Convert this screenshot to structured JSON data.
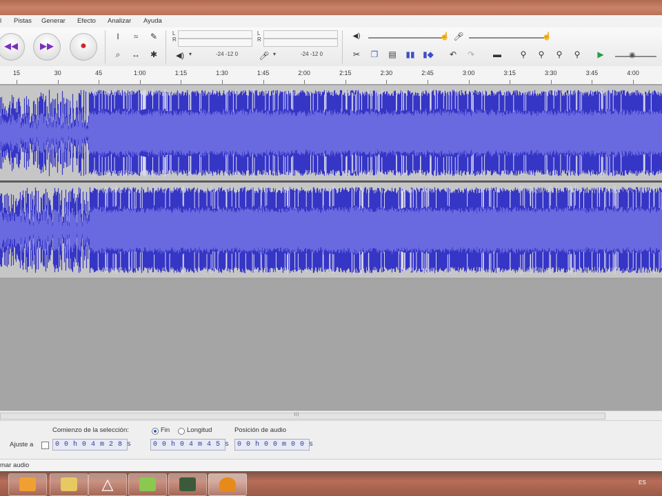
{
  "menu": [
    "l",
    "Pistas",
    "Generar",
    "Efecto",
    "Analizar",
    "Ayuda"
  ],
  "toolbar": {
    "meter_left_label": "L\nR",
    "meter_right_label": "L\nR",
    "scale_left": "-24  -12   0",
    "scale_right": "-24  -12   0"
  },
  "ruler": {
    "ticks": [
      "15",
      "30",
      "45",
      "1:00",
      "1:15",
      "1:30",
      "1:45",
      "2:00",
      "2:15",
      "2:30",
      "2:45",
      "3:00",
      "3:15",
      "3:30",
      "3:45",
      "4:00"
    ]
  },
  "selection": {
    "start_label": "Comienzo de la selección:",
    "fin_label": "Fin",
    "length_label": "Longitud",
    "position_label": "Posición de audio",
    "snap_label": "Ajuste a",
    "start_value": "0 0 h 0 4 m 2 8 s",
    "end_value": "0 0 h 0 4 m 4 5 s",
    "position_value": "0 0 h 0 0 m 0 0 s"
  },
  "status": {
    "text": "mar audio"
  },
  "tray": {
    "lang": "ES"
  },
  "colors": {
    "wave_dark": "#3535c6",
    "wave_light": "#6a6ae0",
    "wave_bg": "#c6c6c6"
  }
}
